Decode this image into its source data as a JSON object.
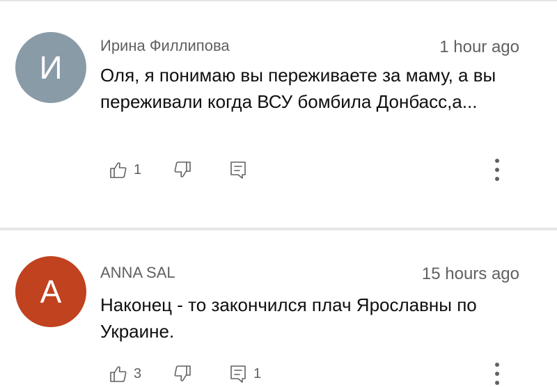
{
  "comments": [
    {
      "avatar_letter": "И",
      "avatar_color": "#8a9ba8",
      "author": "Ирина Филлипова",
      "time": "1 hour ago",
      "text": "Оля, я понимаю вы переживаете за маму, а вы переживали когда ВСУ бомбила Донбасс,а...",
      "likes": "1",
      "replies": ""
    },
    {
      "avatar_letter": "A",
      "avatar_color": "#c0421e",
      "author": "ANNA SAL",
      "time": "15 hours ago",
      "text": "Наконец - то закончился плач Ярославны по Украине.",
      "likes": "3",
      "replies": "1"
    }
  ],
  "icons": {
    "like": "thumb-up-icon",
    "dislike": "thumb-down-icon",
    "reply": "reply-comment-icon",
    "more": "more-vertical-icon"
  },
  "colors": {
    "meta_text": "#606060",
    "body_text": "#0f0f0f",
    "divider": "#e6e6e6"
  }
}
